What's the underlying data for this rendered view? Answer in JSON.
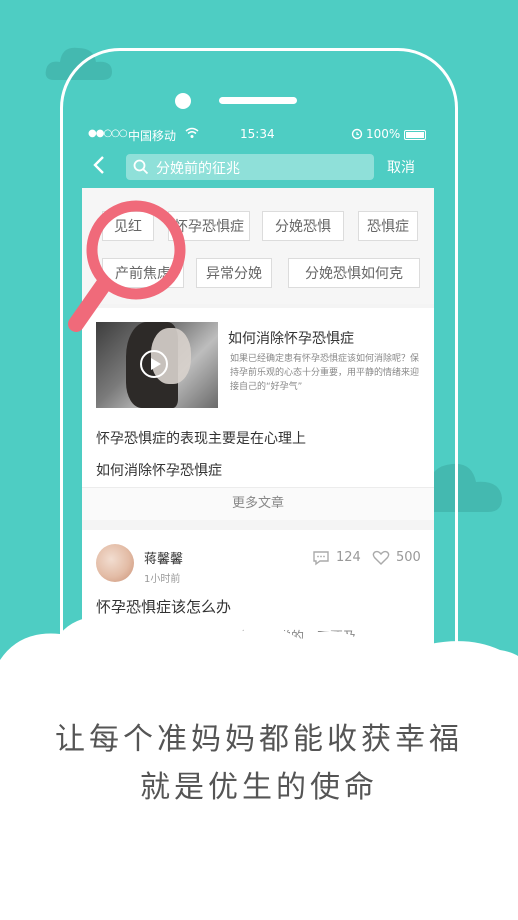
{
  "statusbar": {
    "signal": "●●○○○",
    "carrier": "中国移动",
    "time": "15:34",
    "battery": "100%"
  },
  "navbar": {
    "search_value": "分娩前的征兆",
    "cancel_label": "取消"
  },
  "tags": [
    "见红",
    "怀孕恐惧症",
    "分娩恐惧",
    "恐惧症",
    "产前焦虑",
    "异常分娩",
    "分娩恐惧如何克"
  ],
  "article": {
    "title": "如何消除怀孕恐惧症",
    "desc": "如果已经确定患有怀孕恐惧症该如何消除呢？保持孕前乐观的心态十分重要，用平静的情绪来迎接自己的“好孕气”",
    "links": [
      "怀孕恐惧症的表现主要是在心理上",
      "如何消除怀孕恐惧症"
    ],
    "more_label": "更多文章"
  },
  "post": {
    "username": "蒋馨馨",
    "time": "1小时前",
    "comments": "124",
    "likes": "500",
    "title": "怀孕恐惧症该怎么办",
    "snippet": "在怀孕前后阶段的心理变化是正常的，不要及"
  },
  "slogan": {
    "line1": "让每个准妈妈都能收获幸福",
    "line2": "就是优生的使命"
  },
  "colors": {
    "brand": "#4ecdc3",
    "magnifier": "#f06a7a"
  }
}
